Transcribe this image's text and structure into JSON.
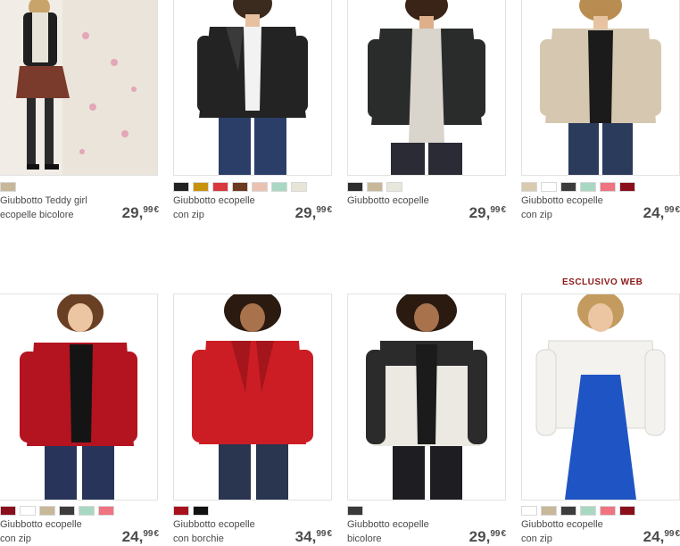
{
  "products": [
    {
      "name_line1": "Giubbotto Teddy girl",
      "name_line2": "ecopelle bicolore",
      "price_int": "29,",
      "price_dec": "99",
      "currency": "€",
      "swatches": [
        "#c8b89a"
      ],
      "image_theme": {
        "bg": "#f1ece6",
        "jacket": "#1f1f1f",
        "skin": "#e9c7a6",
        "hair": "#c9a46a",
        "legs": "#2a2a2a"
      }
    },
    {
      "name_line1": "Giubbotto ecopelle",
      "name_line2": "con zip",
      "price_int": "29,",
      "price_dec": "99",
      "currency": "€",
      "swatches": [
        "#222222",
        "#c8920f",
        "#d9383d",
        "#6b3a1f",
        "#eac3b0",
        "#a9d8c2",
        "#e8e5d8"
      ],
      "image_theme": {
        "bg": "#ffffff",
        "jacket": "#232323",
        "skin": "#e7c0a0",
        "hair": "#3b2a1e",
        "legs": "#2b3e68"
      }
    },
    {
      "name_line1": "Giubbotto ecopelle",
      "name_line2": "",
      "price_int": "29,",
      "price_dec": "99",
      "currency": "€",
      "swatches": [
        "#2d2d2d",
        "#c8b89a",
        "#e9e6dc"
      ],
      "image_theme": {
        "bg": "#ffffff",
        "jacket": "#2a2b2b",
        "skin": "#ddb08b",
        "hair": "#3a2418",
        "legs": "#2b2b35"
      }
    },
    {
      "name_line1": "Giubbotto ecopelle",
      "name_line2": "con zip",
      "price_int": "24,",
      "price_dec": "99",
      "currency": "€",
      "swatches": [
        "#d9cbb0",
        "#ffffff",
        "#3c3c3c",
        "#a9d8c2",
        "#ef7380",
        "#8a0e1b"
      ],
      "image_theme": {
        "bg": "#ffffff",
        "jacket": "#d6c7b0",
        "skin": "#e8c3a2",
        "hair": "#b98d52",
        "legs": "#2b3b5c"
      }
    },
    {
      "name_line1": "Giubbotto ecopelle",
      "name_line2": "con zip",
      "price_int": "24,",
      "price_dec": "99",
      "currency": "€",
      "swatches": [
        "#8a0e1b",
        "#ffffff",
        "#c8b89a",
        "#3c3c3c",
        "#a9d8c2",
        "#ef7380"
      ],
      "image_theme": {
        "bg": "#ffffff",
        "jacket": "#b3141f",
        "skin": "#ecc5a2",
        "hair": "#6a4024",
        "legs": "#28345a"
      }
    },
    {
      "name_line1": "Giubbotto ecopelle",
      "name_line2": "con borchie",
      "price_int": "34,",
      "price_dec": "99",
      "currency": "€",
      "swatches": [
        "#a8121f",
        "#111111"
      ],
      "image_theme": {
        "bg": "#ffffff",
        "jacket": "#cc1d25",
        "skin": "#a8724c",
        "hair": "#2a1a10",
        "legs": "#2a3550"
      }
    },
    {
      "name_line1": "Giubbotto ecopelle",
      "name_line2": "bicolore",
      "price_int": "29,",
      "price_dec": "99",
      "currency": "€",
      "swatches": [
        "#3a3a3a"
      ],
      "image_theme": {
        "bg": "#ffffff",
        "jacket": "#2b2b2b",
        "skin": "#a8724c",
        "hair": "#2a1a10",
        "legs": "#1e1e22"
      }
    },
    {
      "name_line1": "Giubbotto ecopelle",
      "name_line2": "con zip",
      "price_int": "24,",
      "price_dec": "99",
      "currency": "€",
      "swatches": [
        "#ffffff",
        "#c8b89a",
        "#3c3c3c",
        "#a9d8c2",
        "#ef7380",
        "#8a0e1b"
      ],
      "image_theme": {
        "bg": "#ffffff",
        "jacket": "#f4f2ee",
        "skin": "#ecc5a2",
        "hair": "#c49b5e",
        "legs": "#1f54c4"
      }
    }
  ],
  "badge": {
    "exclusive_label": "ESCLUSIVO WEB"
  }
}
